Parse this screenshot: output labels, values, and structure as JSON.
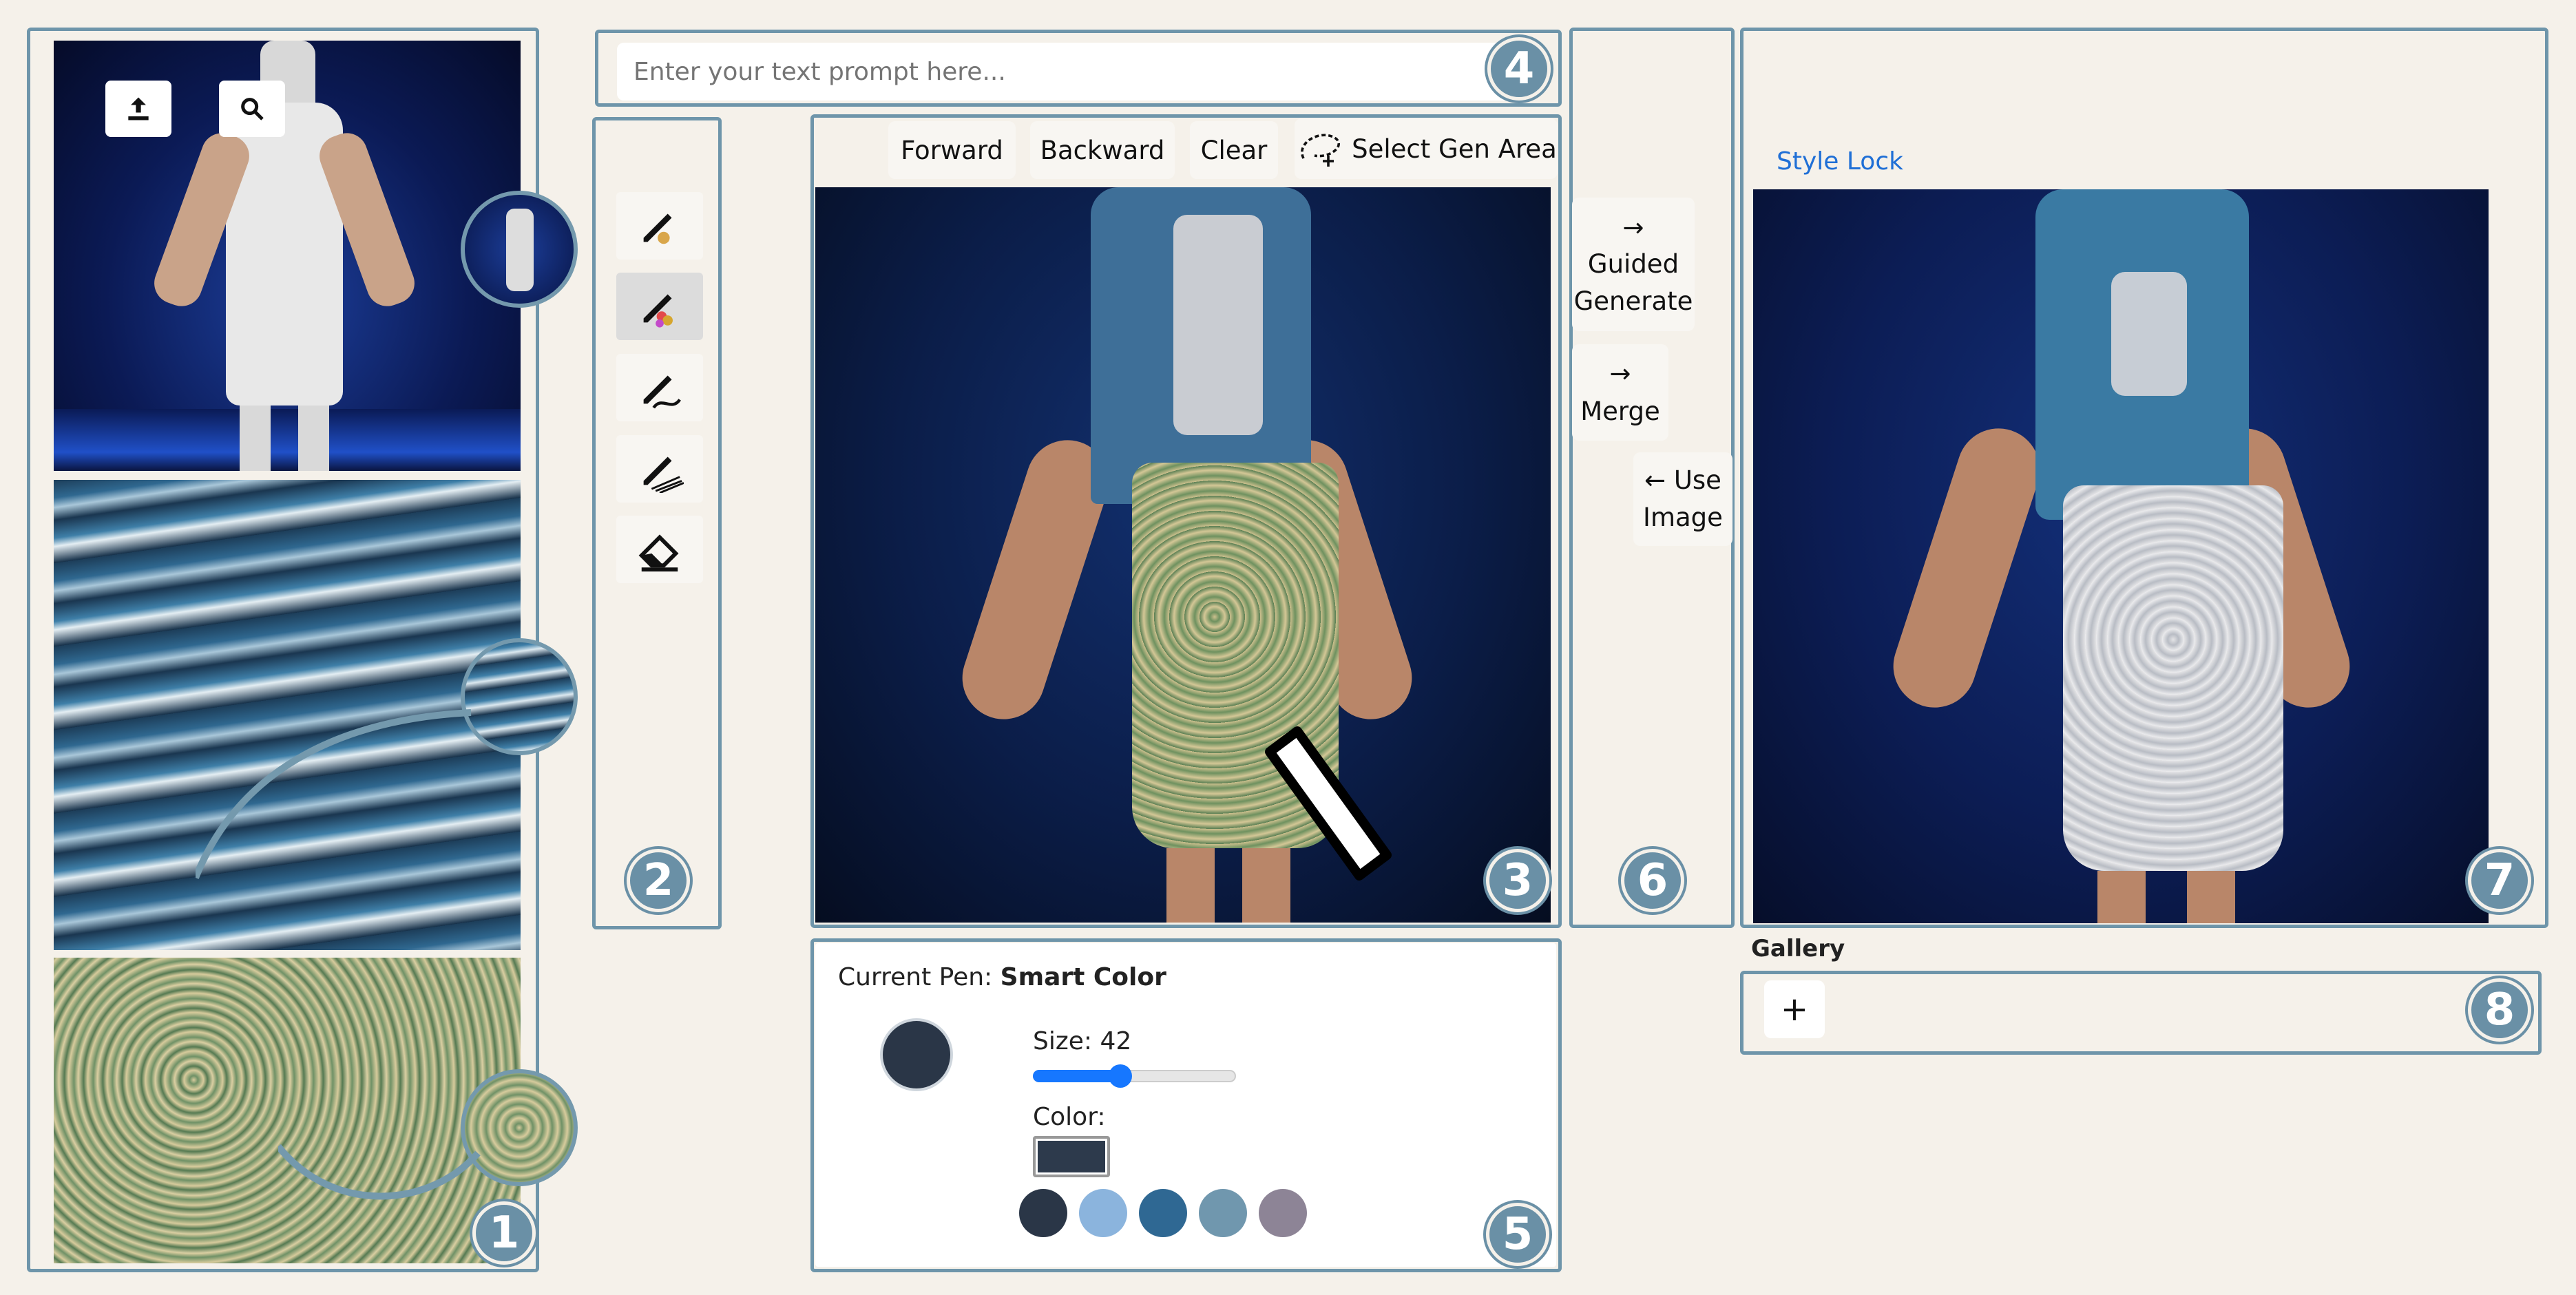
{
  "prompt": {
    "placeholder": "Enter your text prompt here..."
  },
  "badges": {
    "b1": "1",
    "b2": "2",
    "b3": "3",
    "b4": "4",
    "b5": "5",
    "b6": "6",
    "b7": "7",
    "b8": "8"
  },
  "toolbar": {
    "forward": "Forward",
    "backward": "Backward",
    "clear": "Clear",
    "select_gen_area": "Select Gen Area"
  },
  "actions": {
    "guided_arrow": "→",
    "guided_line1": "Guided",
    "guided_line2": "Generate",
    "merge_arrow": "→",
    "merge": "Merge",
    "use_arrow": "←",
    "use_line1": "Use",
    "use_line2": "Image"
  },
  "output": {
    "style_lock": "Style Lock"
  },
  "gallery": {
    "title": "Gallery",
    "add": "+"
  },
  "pen": {
    "label": "Current Pen:",
    "name": "Smart Color",
    "size_label": "Size: 42",
    "size_value": 42,
    "color_label": "Color:",
    "current_color": "#2d3a4c"
  },
  "palette": [
    "#2a3647",
    "#8bb4dd",
    "#2f6893",
    "#7097ae",
    "#8d8496"
  ],
  "colors": {
    "frame": "#6e95aa",
    "background": "#f5f1ea",
    "link": "#1f6fd6",
    "slider": "#1677ff"
  }
}
